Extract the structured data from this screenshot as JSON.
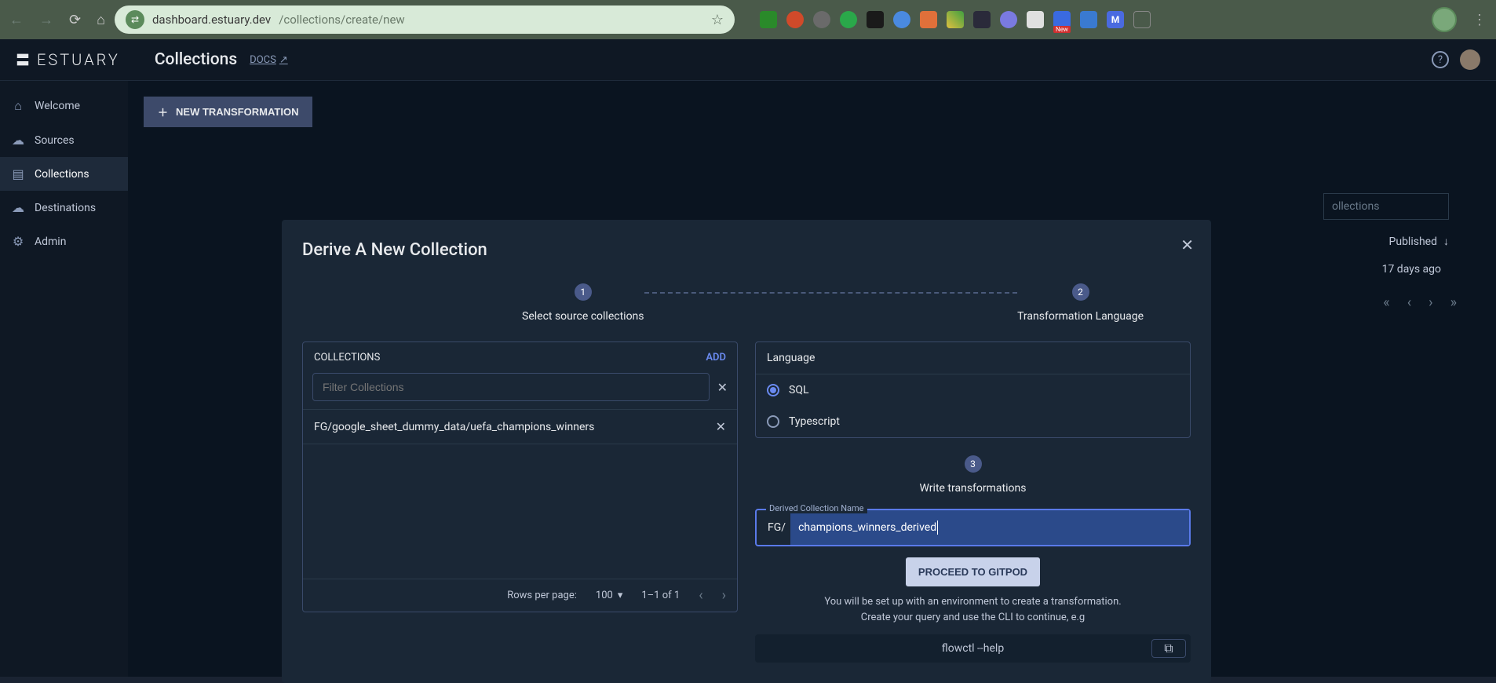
{
  "browser": {
    "url_full": "dashboard.estuary.dev/collections/create/new",
    "url_host": "dashboard.estuary.dev",
    "url_path": "/collections/create/new"
  },
  "header": {
    "logo_text": "ESTUARY",
    "title": "Collections",
    "docs_label": "DOCS"
  },
  "sidebar": {
    "items": [
      {
        "label": "Welcome"
      },
      {
        "label": "Sources"
      },
      {
        "label": "Collections"
      },
      {
        "label": "Destinations"
      },
      {
        "label": "Admin"
      }
    ]
  },
  "toolbar": {
    "new_transformation": "NEW TRANSFORMATION"
  },
  "background": {
    "search_placeholder": "ollections",
    "published_label": "Published",
    "published_value": "17 days ago"
  },
  "modal": {
    "title": "Derive A New Collection",
    "step1": {
      "num": "1",
      "label": "Select source collections"
    },
    "step2": {
      "num": "2",
      "label": "Transformation Language"
    },
    "step3": {
      "num": "3",
      "label": "Write transformations"
    },
    "collections": {
      "header": "COLLECTIONS",
      "add": "ADD",
      "filter_placeholder": "Filter Collections",
      "items": [
        "FG/google_sheet_dummy_data/uefa_champions_winners"
      ],
      "rows_per_page_label": "Rows per page:",
      "rows_per_page_value": "100",
      "range": "1–1 of 1"
    },
    "language": {
      "header": "Language",
      "options": [
        "SQL",
        "Typescript"
      ],
      "selected": "SQL"
    },
    "derived": {
      "float_label": "Derived Collection Name",
      "prefix": "FG/",
      "value": "champions_winners_derived"
    },
    "proceed_label": "PROCEED TO GITPOD",
    "hint_line1": "You will be set up with an environment to create a transformation.",
    "hint_line2": "Create your query and use the CLI to continue, e.g",
    "command": "flowctl --help"
  }
}
